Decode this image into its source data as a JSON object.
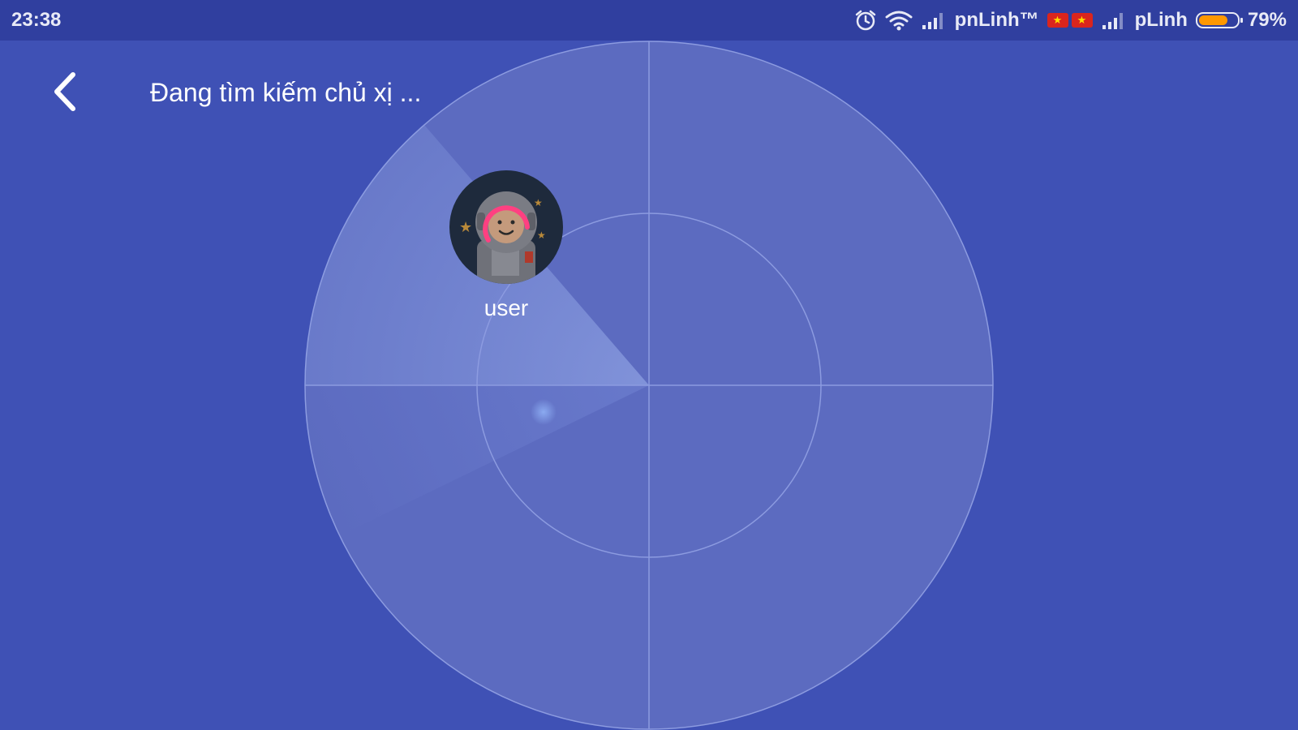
{
  "status_bar": {
    "time": "23:38",
    "carrier1": "pnLinh™",
    "carrier2": "pLinh",
    "battery_text": "79%",
    "battery_level": 0.79,
    "icons": [
      "alarm-icon",
      "wifi-icon",
      "signal-icon",
      "vn-flag-icon",
      "signal-icon",
      "battery-icon"
    ]
  },
  "header": {
    "back_icon": "chevron-left-icon",
    "title": "Đang tìm kiếm chủ xị ..."
  },
  "radar": {
    "found_user": {
      "name": "user",
      "avatar": "astronaut-avatar"
    }
  },
  "colors": {
    "background": "#3f51b5",
    "status_bar": "#303f9f",
    "radar_fill": "#5c6bc0",
    "battery": "#ff9800",
    "accent_ring": "#ff4081"
  }
}
